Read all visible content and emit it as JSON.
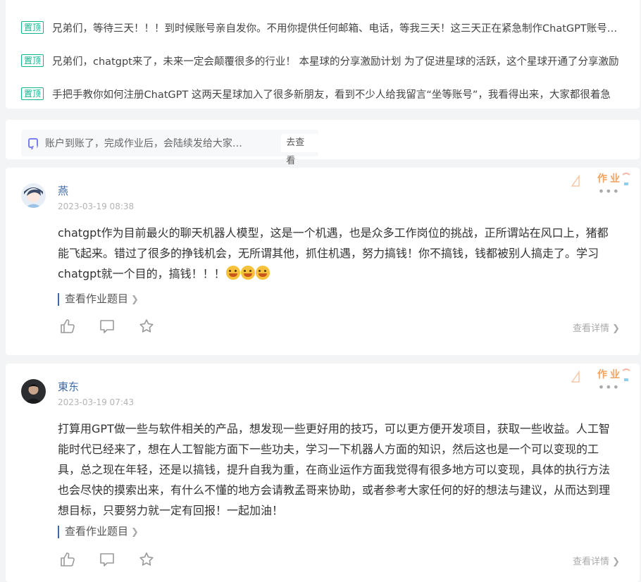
{
  "pinned": {
    "tag": "置顶",
    "items": [
      "兄弟们，等待三天！！！到时候账号亲自发你。不用你提供任何邮箱、电话，等我三天！这三天正在紧急制作ChatGPT账号，三天后统一发放",
      "兄弟们，chatgpt来了，未来一定会颠覆很多的行业！ 本星球的分享激励计划 为了促进星球的活跃，这个星球开通了分享激励",
      "手把手教你如何注册ChatGPT 这两天星球加入了很多新朋友，看到不少人给我留言“坐等账号”，我看得出来，大家都很着急"
    ]
  },
  "notice": {
    "text": "账户到账了，完成作业后，会陆续发给大家…",
    "button": "去查看"
  },
  "posts": [
    {
      "author": "燕",
      "time": "2023-03-19 08:38",
      "badge": "作业",
      "content": "chatgpt作为目前最火的聊天机器人模型，这是一个机遇，也是众多工作岗位的挑战，正所谓站在风口上，猪都能飞起来。错过了很多的挣钱机会，无所谓其他，抓住机遇，努力搞钱！你不搞钱，钱都被别人搞走了。学习chatgpt就一个目的，搞钱！！！",
      "homework_link": "查看作业题目",
      "detail": "查看详情"
    },
    {
      "author": "東东",
      "time": "2023-03-19 07:43",
      "badge": "作业",
      "content": "打算用GPT做一些与软件相关的产品，想发现一些更好用的技巧，可以更方便开发项目，获取一些收益。人工智能时代已经来了，想在人工智能方面下一些功夫，学习一下机器人方面的知识，然后这也是一个可以变现的工具，总之现在年轻，还是以搞钱，提升自我为重，在商业运作方面我觉得有很多地方可以变现，具体的执行方法也会尽快的摸索出来，有什么不懂的地方会请教孟哥来协助，或者参考大家任何的好的想法与建议，从而达到理想目标，只要努力就一定有回报！一起加油！",
      "homework_link": "查看作业题目",
      "detail": "查看详情"
    }
  ],
  "icons": {
    "like": "thumbs-up-icon",
    "comment": "comment-icon",
    "favorite": "star-icon",
    "more": "more-dots-icon",
    "notice": "notice-icon"
  },
  "colors": {
    "pin_tag": "#13b58f",
    "author": "#3d6aa6",
    "badge": "#f1a35f",
    "notice_icon": "#7b7df0"
  }
}
